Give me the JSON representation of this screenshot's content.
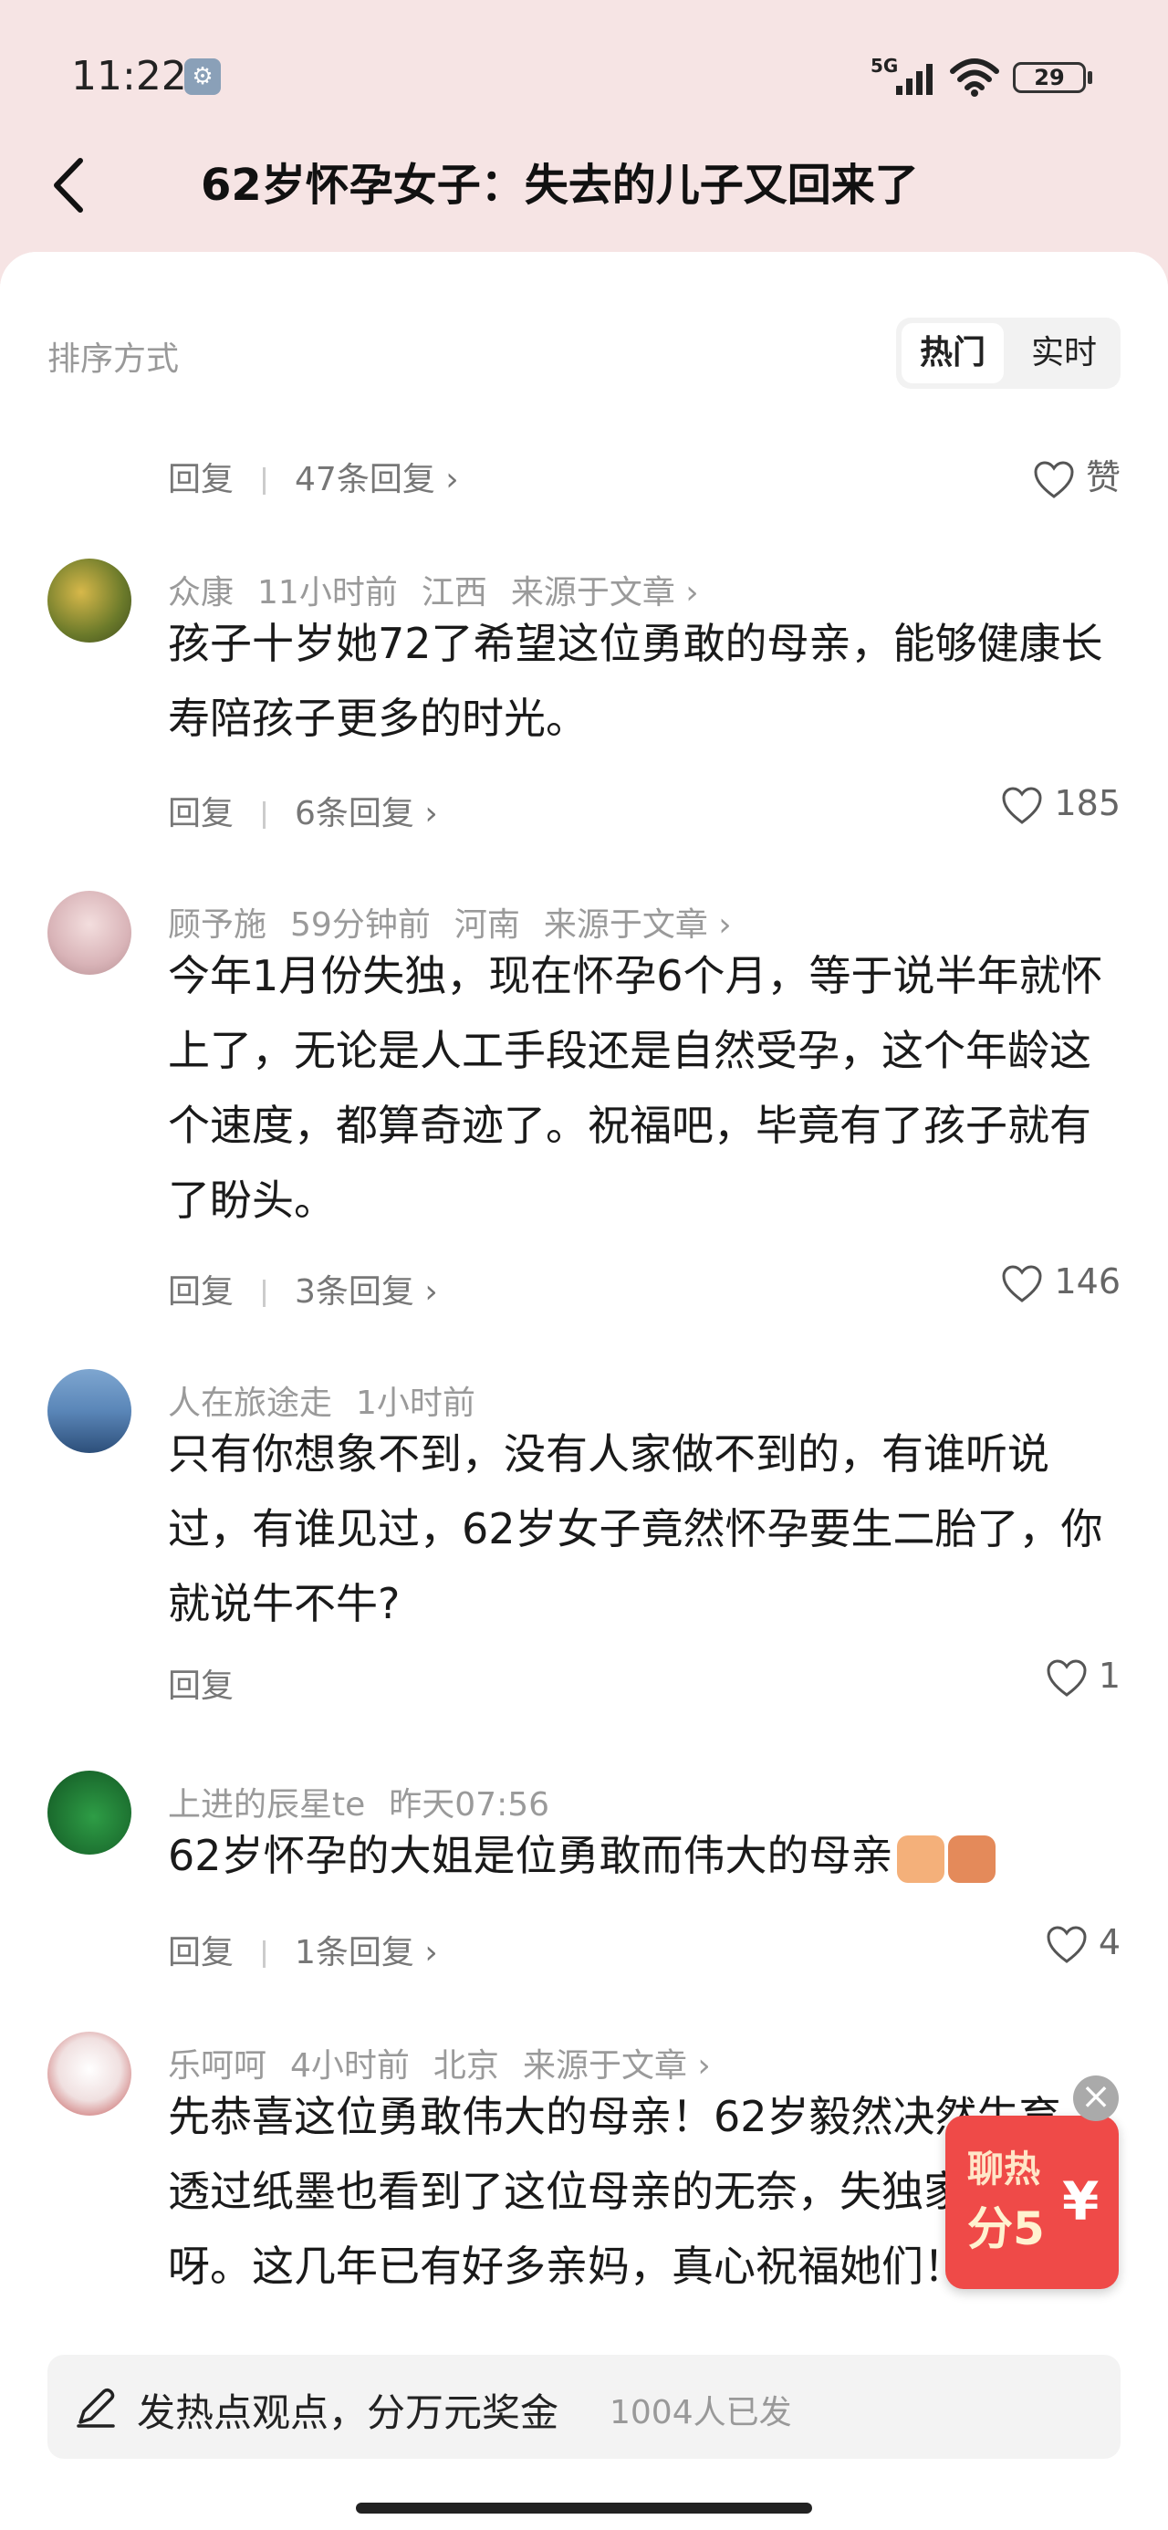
{
  "status_bar": {
    "time": "11:22",
    "network": "5G",
    "battery": "29"
  },
  "header": {
    "title": "62岁怀孕女子：失去的儿子又回来了"
  },
  "sort": {
    "label": "排序方式",
    "options": [
      "热门",
      "实时"
    ],
    "selected": "热门"
  },
  "partial_top_row": {
    "reply_label": "回复",
    "replies_link": "47条回复 ›",
    "like_label": "赞"
  },
  "comments": [
    {
      "user": "众康",
      "time": "11小时前",
      "location": "江西",
      "source": "来源于文章 ›",
      "text": "孩子十岁她72了希望这位勇敢的母亲，能够健康长寿陪孩子更多的时光。",
      "reply_label": "回复",
      "replies_link": "6条回复 ›",
      "likes": "185"
    },
    {
      "user": "顾予施",
      "time": "59分钟前",
      "location": "河南",
      "source": "来源于文章 ›",
      "text": "今年1月份失独，现在怀孕6个月，等于说半年就怀上了，无论是人工手段还是自然受孕，这个年龄这个速度，都算奇迹了。祝福吧，毕竟有了孩子就有了盼头。",
      "reply_label": "回复",
      "replies_link": "3条回复 ›",
      "likes": "146"
    },
    {
      "user": "人在旅途走",
      "time": "1小时前",
      "text": "只有你想象不到，没有人家做不到的，有谁听说过，有谁见过，62岁女子竟然怀孕要生二胎了，你就说牛不牛?",
      "reply_label": "回复",
      "likes": "1"
    },
    {
      "user": "上进的辰星te",
      "time": "昨天07:56",
      "text": "62岁怀孕的大姐是位勇敢而伟大的母亲",
      "reply_label": "回复",
      "replies_link": "1条回复 ›",
      "likes": "4"
    },
    {
      "user": "乐呵呵",
      "time": "4小时前",
      "location": "北京",
      "source": "来源于文章 ›",
      "text": "先恭喜这位勇敢伟大的母亲！62岁毅然决然生育。透过纸墨也看到了这位母亲的无奈，失独家庭的痛呀。这几年已有好多亲妈，真心祝福她们！"
    }
  ],
  "floating_ad": {
    "line1": "聊热",
    "line2": "分5",
    "symbol": "¥",
    "close": "×"
  },
  "bottom_bar": {
    "prompt": "发热点观点，分万元奖金",
    "count": "1004人已发"
  }
}
